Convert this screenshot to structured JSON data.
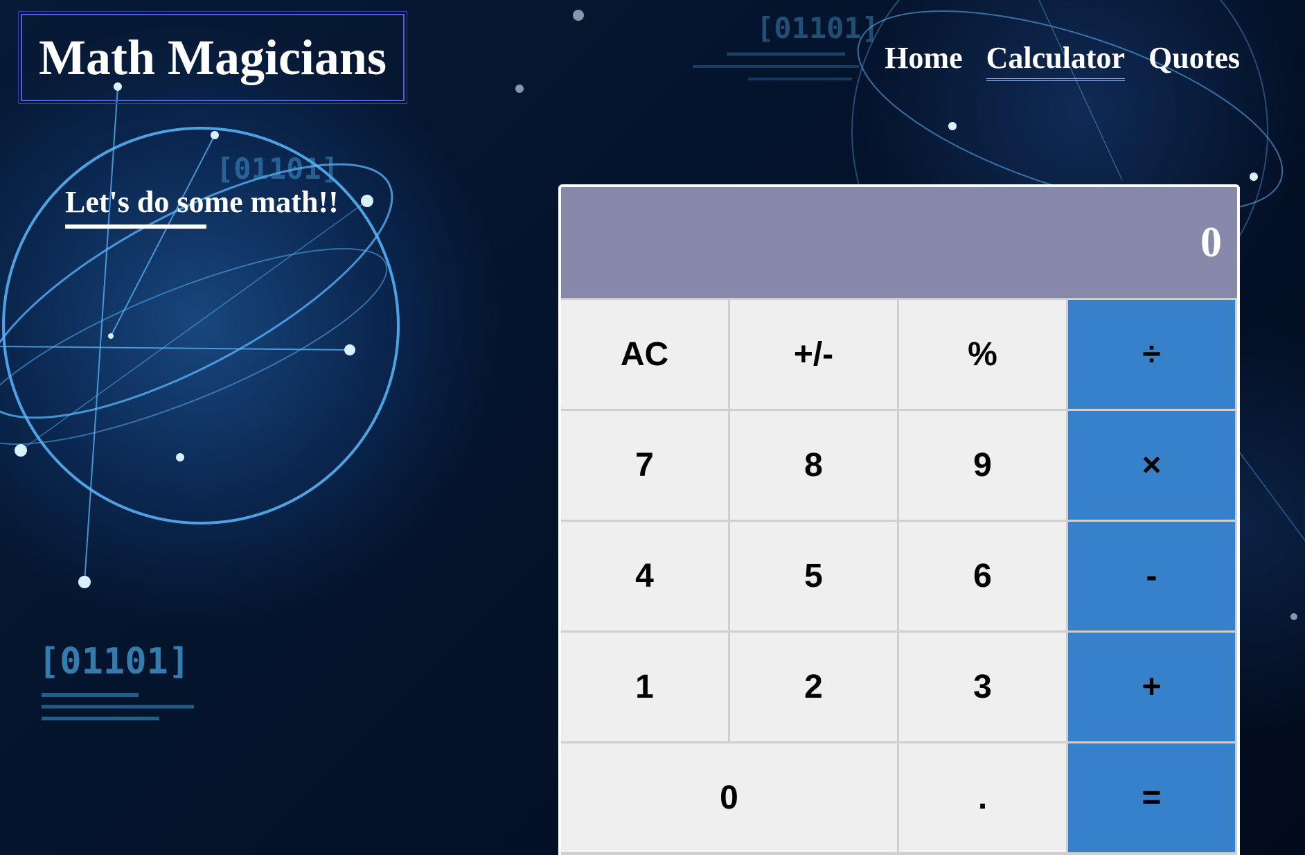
{
  "header": {
    "logo_title": "Math Magicians",
    "nav": [
      {
        "label": "Home"
      },
      {
        "label": "Calculator",
        "active": true
      },
      {
        "label": "Quotes"
      }
    ]
  },
  "intro": {
    "tagline": "Let's do some math!!"
  },
  "background": {
    "binary_text": "[01101]"
  },
  "calculator": {
    "display_value": "0",
    "keys": [
      {
        "label": "AC",
        "type": "function"
      },
      {
        "label": "+/-",
        "type": "function"
      },
      {
        "label": "%",
        "type": "function"
      },
      {
        "label": "÷",
        "type": "operator"
      },
      {
        "label": "7",
        "type": "digit"
      },
      {
        "label": "8",
        "type": "digit"
      },
      {
        "label": "9",
        "type": "digit"
      },
      {
        "label": "×",
        "type": "operator"
      },
      {
        "label": "4",
        "type": "digit"
      },
      {
        "label": "5",
        "type": "digit"
      },
      {
        "label": "6",
        "type": "digit"
      },
      {
        "label": "-",
        "type": "operator"
      },
      {
        "label": "1",
        "type": "digit"
      },
      {
        "label": "2",
        "type": "digit"
      },
      {
        "label": "3",
        "type": "digit"
      },
      {
        "label": "+",
        "type": "operator"
      },
      {
        "label": "0",
        "type": "digit"
      },
      {
        "label": ".",
        "type": "digit"
      },
      {
        "label": "=",
        "type": "operator"
      }
    ]
  },
  "colors": {
    "display_bg": "#8689aa",
    "key_bg": "#efefef",
    "operator_bg": "#3681c9",
    "logo_border": "#5260e0"
  }
}
